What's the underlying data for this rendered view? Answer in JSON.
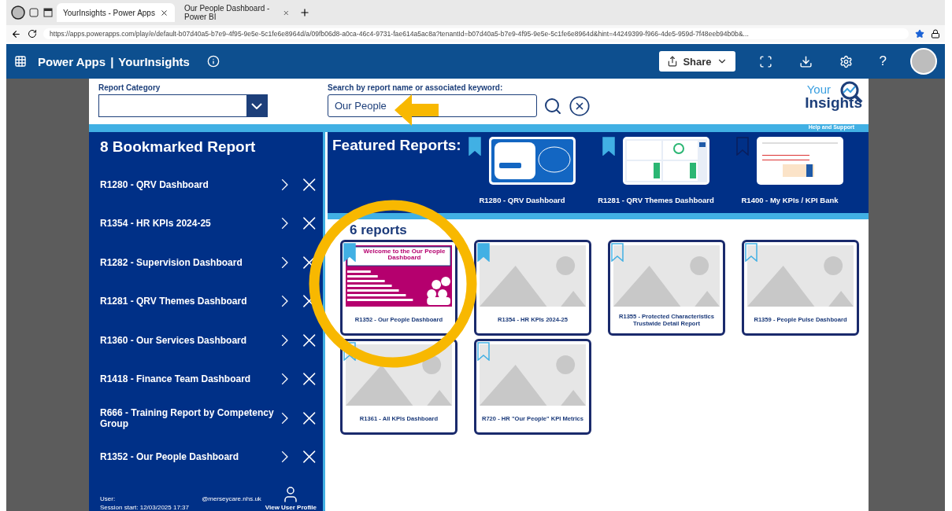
{
  "browser": {
    "tabs": [
      {
        "title": "YourInsights - Power Apps",
        "selected": true
      },
      {
        "title": "Our People Dashboard - Power BI",
        "selected": false
      }
    ],
    "url": "https://apps.powerapps.com/play/e/default-b07d40a5-b7e9-4f95-9e5e-5c1fe6e8964d/a/09fb06d8-a0ca-46c4-9731-fae614a5ac8a?tenantId=b07d40a5-b7e9-4f95-9e5e-5c1fe6e8964d&hint=44249399-f966-4de5-959d-7f48eeb94b0b&..."
  },
  "app_header": {
    "product": "Power Apps",
    "separator": "|",
    "app_name": "YourInsights",
    "share": "Share",
    "help": "?"
  },
  "filters": {
    "category_label": "Report Category",
    "search_label": "Search by report name or associated keyword:",
    "search_value": "Our People"
  },
  "logo": {
    "line1": "Your",
    "line2": "Insights",
    "help": "Help and Support"
  },
  "bookmarks": {
    "title": "8 Bookmarked Report",
    "items": [
      {
        "name": "R1280 - QRV Dashboard"
      },
      {
        "name": "R1354 - HR KPIs 2024-25"
      },
      {
        "name": "R1282 - Supervision Dashboard"
      },
      {
        "name": "R1281 - QRV Themes Dashboard"
      },
      {
        "name": "R1360 - Our Services Dashboard"
      },
      {
        "name": "R1418 - Finance Team Dashboard"
      },
      {
        "name": "R666 - Training Report by Competency Group"
      },
      {
        "name": "R1352 - Our People Dashboard"
      }
    ]
  },
  "featured": {
    "title": "Featured Reports:",
    "items": [
      {
        "name": "R1280 - QRV Dashboard",
        "kind": "welcome",
        "bookmarked": true
      },
      {
        "name": "R1281 - QRV Themes Dashboard",
        "kind": "grid",
        "bookmarked": true
      },
      {
        "name": "R1400 - My KPIs / KPI Bank",
        "kind": "table",
        "bookmarked": false
      }
    ]
  },
  "results": {
    "count": "6 reports",
    "items": [
      {
        "name": "R1352 - Our People Dashboard",
        "kind": "preview",
        "thumbnail_title": "Welcome to the Our People Dashboard",
        "bookmarked": true
      },
      {
        "name": "R1354 - HR KPIs 2024-25",
        "kind": "placeholder",
        "bookmarked": true
      },
      {
        "name": "R1355 - Protected Characteristics Trustwide Detail Report",
        "kind": "placeholder",
        "bookmarked": false
      },
      {
        "name": "R1359 - People Pulse Dashboard",
        "kind": "placeholder",
        "bookmarked": false
      },
      {
        "name": "R1361 - All KPIs Dashboard",
        "kind": "placeholder",
        "bookmarked": false
      },
      {
        "name": "R720 - HR \"Our People\" KPI Metrics",
        "kind": "placeholder",
        "bookmarked": false
      }
    ]
  },
  "footer": {
    "user_label": "User:",
    "user_value": "@merseycare.nhs.uk",
    "session": "Session start: 12/03/2025 17:37",
    "profile": "View User Profile"
  }
}
